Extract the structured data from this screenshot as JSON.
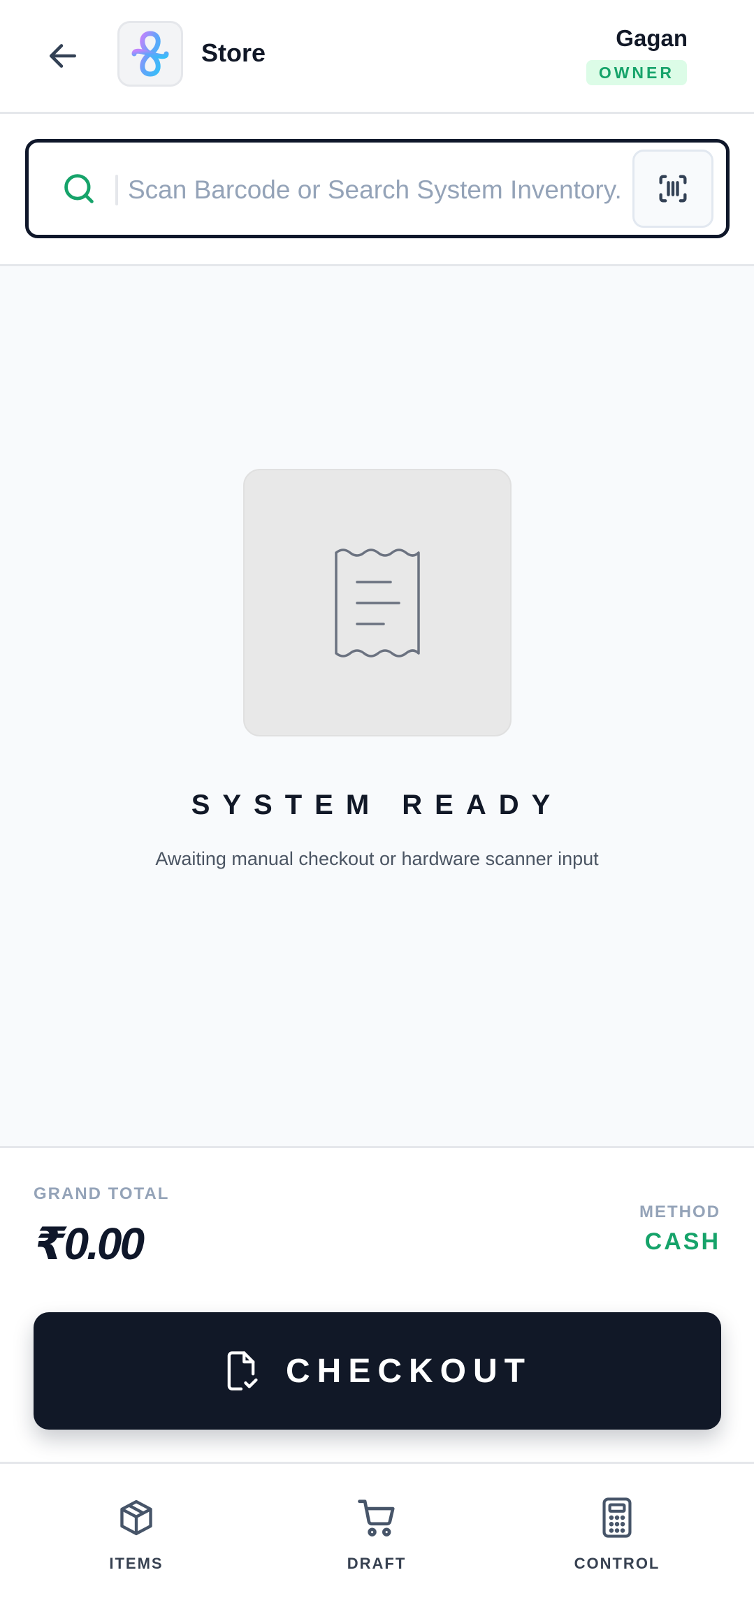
{
  "header": {
    "store_name": "Store",
    "user_name": "Gagan",
    "role": "OWNER"
  },
  "search": {
    "placeholder": "Scan Barcode or Search System Inventory."
  },
  "empty_state": {
    "title": "SYSTEM READY",
    "subtitle": "Awaiting manual checkout or hardware scanner input"
  },
  "summary": {
    "grand_total_label": "GRAND TOTAL",
    "grand_total_value": "₹0.00",
    "method_label": "METHOD",
    "method_value": "CASH"
  },
  "checkout": {
    "label": "CHECKOUT"
  },
  "nav": {
    "items": [
      {
        "label": "ITEMS",
        "icon": "box-icon"
      },
      {
        "label": "DRAFT",
        "icon": "cart-icon"
      },
      {
        "label": "CONTROL",
        "icon": "calculator-icon"
      }
    ]
  },
  "colors": {
    "accent_green": "#16a36a",
    "dark_navy": "#111827",
    "muted": "#94a3b8"
  }
}
